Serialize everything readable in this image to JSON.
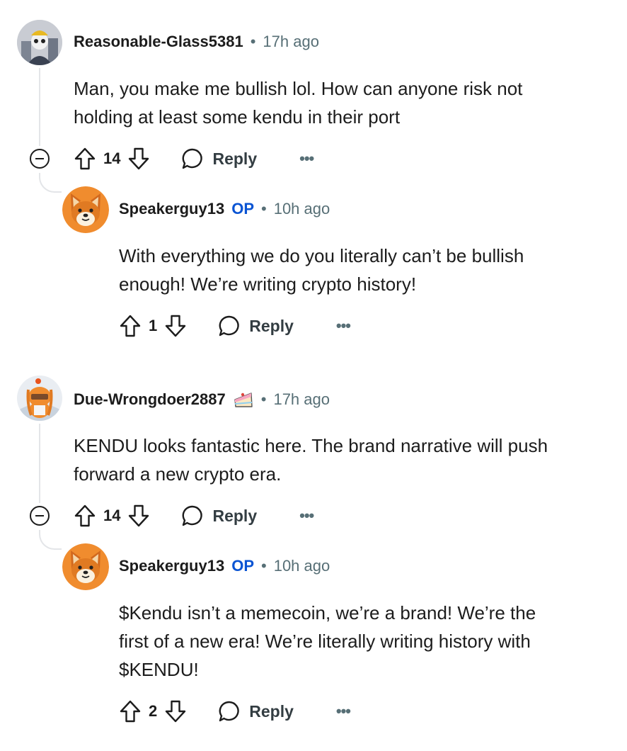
{
  "comments": [
    {
      "author": "Reasonable-Glass5381",
      "time": "17h ago",
      "body_lines": [
        "Man, you make me bullish lol. How can anyone risk not",
        "holding at least some kendu in their port"
      ],
      "votes": "14",
      "reply_label": "Reply",
      "more_label": "•••",
      "reply": {
        "author": "Speakerguy13",
        "op_badge": "OP",
        "time": "10h ago",
        "body_lines": [
          "With everything we do you literally can’t be bullish",
          "enough! We’re writing crypto history!"
        ],
        "votes": "1",
        "reply_label": "Reply",
        "more_label": "•••"
      }
    },
    {
      "author": "Due-Wrongdoer2887",
      "time": "17h ago",
      "body_lines": [
        "KENDU looks fantastic here. The brand narrative will push",
        "forward a new crypto era."
      ],
      "votes": "14",
      "reply_label": "Reply",
      "more_label": "•••",
      "reply": {
        "author": "Speakerguy13",
        "op_badge": "OP",
        "time": "10h ago",
        "body_lines": [
          "$Kendu isn’t a memecoin, we’re a brand! We’re the",
          "first of a new era! We’re literally writing history with",
          "$KENDU!"
        ],
        "votes": "2",
        "reply_label": "Reply",
        "more_label": "•••"
      }
    }
  ],
  "separator": "•",
  "colors": {
    "op": "#0a54d3",
    "meta": "#576f76",
    "thread": "#e3e5e8",
    "shiba": "#f08c2e"
  },
  "icons": [
    "upvote-icon",
    "downvote-icon",
    "comment-bubble-icon",
    "collapse-icon",
    "cake-icon"
  ]
}
